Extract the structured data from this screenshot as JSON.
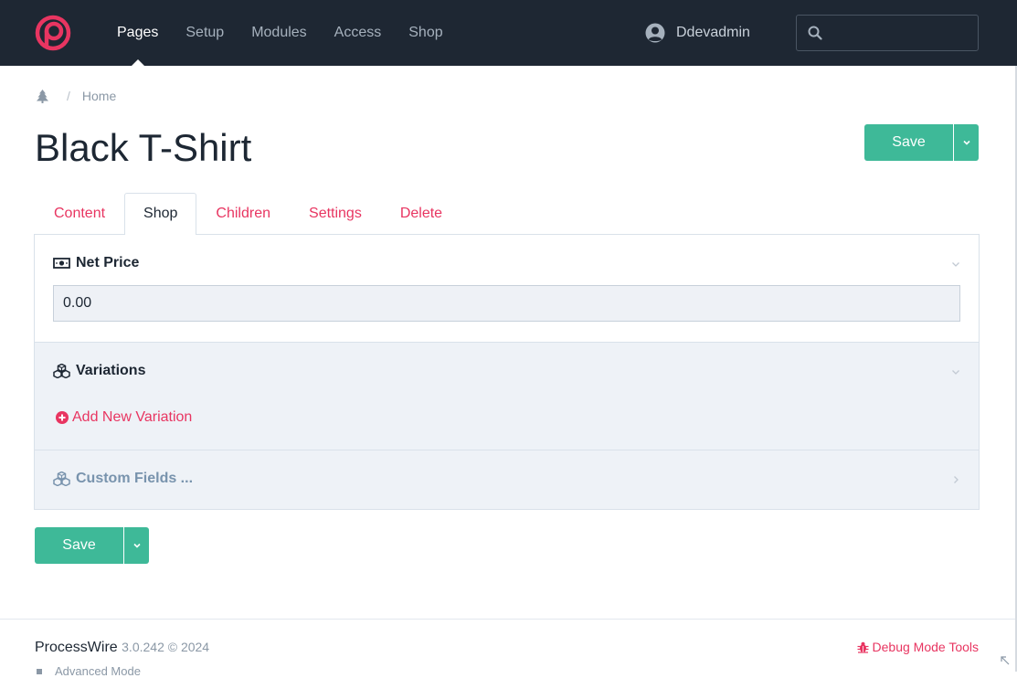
{
  "colors": {
    "nav_bg": "#1e2733",
    "accent": "#e83561",
    "save_green": "#3eb998",
    "panel_bg_alt": "#eef2f7"
  },
  "topnav": {
    "logo": "processwire-logo",
    "items": [
      {
        "label": "Pages",
        "active": true
      },
      {
        "label": "Setup",
        "active": false
      },
      {
        "label": "Modules",
        "active": false
      },
      {
        "label": "Access",
        "active": false
      },
      {
        "label": "Shop",
        "active": false
      }
    ],
    "user": {
      "icon": "user-circle-icon",
      "name": "Ddevadmin"
    },
    "search": {
      "icon": "search-icon",
      "placeholder": ""
    }
  },
  "breadcrumb": {
    "icon": "tree-icon",
    "separator": "/",
    "items": [
      "Home"
    ]
  },
  "page": {
    "title": "Black T-Shirt",
    "save_label": "Save"
  },
  "tabs": [
    {
      "label": "Content",
      "active": false
    },
    {
      "label": "Shop",
      "active": true
    },
    {
      "label": "Children",
      "active": false
    },
    {
      "label": "Settings",
      "active": false
    },
    {
      "label": "Delete",
      "active": false
    }
  ],
  "fields": {
    "net_price": {
      "icon": "money-icon",
      "label": "Net Price",
      "value": "0.00"
    },
    "variations": {
      "icon": "cubes-icon",
      "label": "Variations",
      "add_label": "Add New Variation"
    },
    "custom_fields": {
      "icon": "cubes-icon",
      "label": "Custom Fields ..."
    }
  },
  "footer": {
    "brand": "ProcessWire",
    "version": "3.0.242 © 2024",
    "debug_label": "Debug Mode Tools",
    "advanced_label": "Advanced Mode"
  }
}
